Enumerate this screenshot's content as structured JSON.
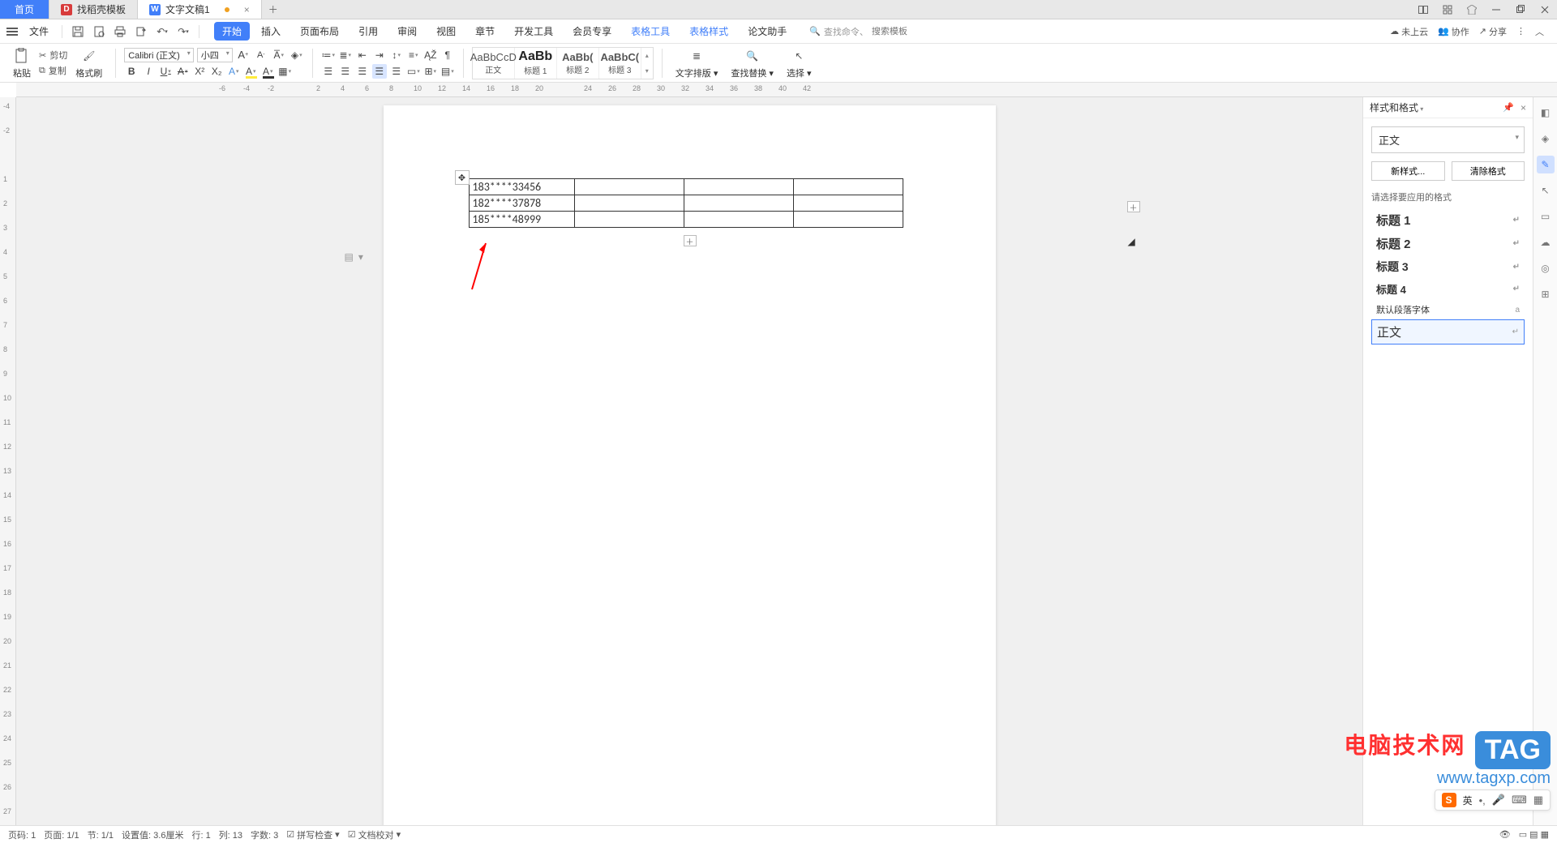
{
  "tabs": {
    "home": "首页",
    "template": "找稻壳模板",
    "doc": "文字文稿1"
  },
  "menubar": {
    "file": "文件",
    "ribbon_tabs": [
      "开始",
      "插入",
      "页面布局",
      "引用",
      "审阅",
      "视图",
      "章节",
      "开发工具",
      "会员专享",
      "表格工具",
      "表格样式",
      "论文助手"
    ],
    "search_prefix": "查找命令、",
    "search_placeholder": "搜索模板",
    "cloud": "未上云",
    "coop": "协作",
    "share": "分享"
  },
  "ribbon": {
    "paste": "粘贴",
    "cut": "剪切",
    "copy": "复制",
    "format_painter": "格式刷",
    "font_name": "Calibri (正文)",
    "font_size": "小四",
    "styles": {
      "normal_preview": "AaBbCcD",
      "normal": "正文",
      "h1_preview": "AaBb",
      "h1": "标题 1",
      "h2_preview": "AaBb(",
      "h2": "标题 2",
      "h3_preview": "AaBbC(",
      "h3": "标题 3"
    },
    "text_layout": "文字排版",
    "find_replace": "查找替换",
    "select": "选择"
  },
  "table": {
    "rows": [
      [
        "183****33456",
        "",
        "",
        ""
      ],
      [
        "182****37878",
        "",
        "",
        ""
      ],
      [
        "185****48999",
        "",
        "",
        ""
      ]
    ]
  },
  "panel": {
    "title": "样式和格式",
    "current": "正文",
    "new_style": "新样式...",
    "clear": "清除格式",
    "hint": "请选择要应用的格式",
    "entries": {
      "h1": "标题 1",
      "h2": "标题 2",
      "h3": "标题 3",
      "h4": "标题 4",
      "default_font": "默认段落字体",
      "normal": "正文"
    }
  },
  "ime": {
    "lang": "英"
  },
  "watermark": {
    "title": "电脑技术网",
    "url": "www.tagxp.com",
    "badge": "TAG"
  },
  "statusbar": {
    "page_no": "页码: 1",
    "page": "页面: 1/1",
    "section": "节: 1/1",
    "pos": "设置值: 3.6厘米",
    "line": "行: 1",
    "col": "列: 13",
    "chars": "字数: 3",
    "spellcheck": "拼写检查",
    "content_check": "文档校对"
  },
  "ruler_h": [
    -6,
    -4,
    -2,
    "",
    2,
    4,
    6,
    8,
    10,
    12,
    14,
    16,
    18,
    20,
    "",
    24,
    26,
    28,
    30,
    32,
    34,
    36,
    38,
    40,
    42
  ],
  "ruler_v": [
    -4,
    -2,
    "",
    1,
    2,
    3,
    4,
    5,
    6,
    7,
    8,
    9,
    10,
    11,
    12,
    13,
    14,
    15,
    16,
    17,
    18,
    19,
    20,
    21,
    22,
    23,
    24,
    25,
    26,
    27
  ]
}
